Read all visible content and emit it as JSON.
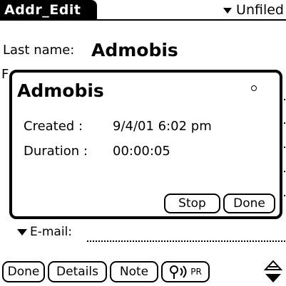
{
  "app": {
    "title": "Addr_Edit",
    "category": "Unfiled"
  },
  "form": {
    "last_name_label": "Last name:",
    "last_name_value": "Admobis",
    "email_label": "E-mail:",
    "hidden_field_initial": "F"
  },
  "buttons": {
    "done": "Done",
    "details": "Details",
    "note": "Note",
    "beam_label": "PR"
  },
  "dialog": {
    "title": "Admobis",
    "created_label": "Created :",
    "created_value": "9/4/01 6:02 pm",
    "duration_label": "Duration :",
    "duration_value": "00:00:05",
    "stop": "Stop",
    "done": "Done"
  }
}
